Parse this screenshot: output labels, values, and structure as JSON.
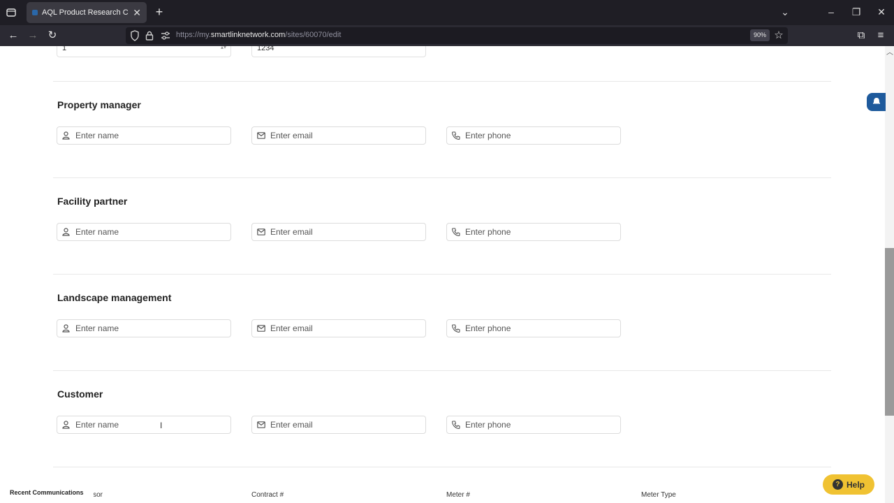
{
  "browser": {
    "tab_title": "AQL Product Research Center P",
    "url_prefix": "https://my.",
    "url_host": "smartlinknetwork.com",
    "url_path": "/sites/60070/edit",
    "zoom": "90%"
  },
  "top_fields": {
    "left_value": "1",
    "right_value": "1234"
  },
  "sections": [
    {
      "title": "Property manager",
      "name_placeholder": "Enter name",
      "email_placeholder": "Enter email",
      "phone_placeholder": "Enter phone"
    },
    {
      "title": "Facility partner",
      "name_placeholder": "Enter name",
      "email_placeholder": "Enter email",
      "phone_placeholder": "Enter phone"
    },
    {
      "title": "Landscape management",
      "name_placeholder": "Enter name",
      "email_placeholder": "Enter email",
      "phone_placeholder": "Enter phone"
    },
    {
      "title": "Customer",
      "name_placeholder": "Enter name",
      "email_placeholder": "Enter email",
      "phone_placeholder": "Enter phone"
    }
  ],
  "bottom_labels": {
    "supervisor": "ervisor",
    "contract": "Contract #",
    "meter": "Meter #",
    "meter_type": "Meter Type"
  },
  "footer": {
    "recent_communications": "Recent Communications",
    "help_label": "Help"
  },
  "colors": {
    "help_bg": "#f0c232",
    "notify_bg": "#1e5a9c",
    "chrome_bg": "#2b2a33"
  }
}
